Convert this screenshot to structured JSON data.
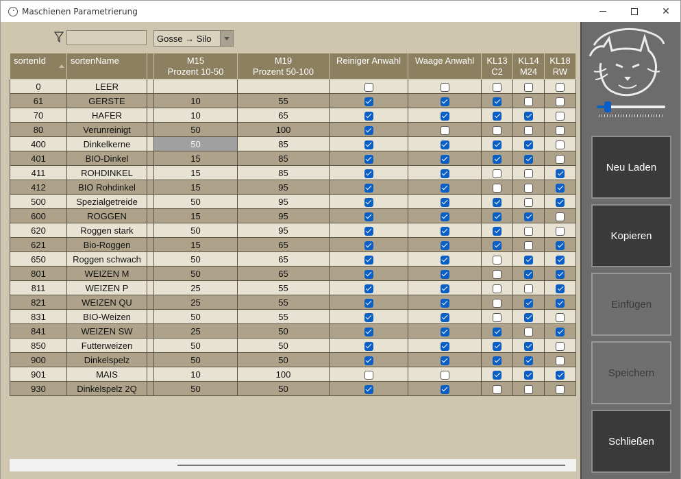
{
  "window": {
    "title": "Maschienen Parametrierung"
  },
  "filter": {
    "value": ""
  },
  "direction": {
    "selected": "Gosse → Silo"
  },
  "table": {
    "headers": [
      {
        "line1": "sortenId",
        "line2": ""
      },
      {
        "line1": "sortenName",
        "line2": ""
      },
      {
        "line1": "",
        "line2": ""
      },
      {
        "line1": "M15",
        "line2": "Prozent 10-50"
      },
      {
        "line1": "M19",
        "line2": "Prozent 50-100"
      },
      {
        "line1": "Reiniger Anwahl",
        "line2": ""
      },
      {
        "line1": "Waage Anwahl",
        "line2": ""
      },
      {
        "line1": "KL13",
        "line2": "C2"
      },
      {
        "line1": "KL14",
        "line2": "M24"
      },
      {
        "line1": "KL18",
        "line2": "RW"
      }
    ],
    "rows": [
      {
        "id": "0",
        "name": "LEER",
        "m15": "",
        "m19": "",
        "reiniger": false,
        "waage": false,
        "kl13": false,
        "kl14": false,
        "kl18": false
      },
      {
        "id": "61",
        "name": "GERSTE",
        "m15": "10",
        "m19": "55",
        "reiniger": true,
        "waage": true,
        "kl13": true,
        "kl14": false,
        "kl18": false
      },
      {
        "id": "70",
        "name": "HAFER",
        "m15": "10",
        "m19": "65",
        "reiniger": true,
        "waage": true,
        "kl13": true,
        "kl14": true,
        "kl18": false
      },
      {
        "id": "80",
        "name": "Verunreinigt",
        "m15": "50",
        "m19": "100",
        "reiniger": true,
        "waage": false,
        "kl13": false,
        "kl14": false,
        "kl18": false
      },
      {
        "id": "400",
        "name": "Dinkelkerne",
        "m15": "50",
        "m19": "85",
        "reiniger": true,
        "waage": true,
        "kl13": true,
        "kl14": true,
        "kl18": false
      },
      {
        "id": "401",
        "name": "BIO-Dinkel",
        "m15": "15",
        "m19": "85",
        "reiniger": true,
        "waage": true,
        "kl13": true,
        "kl14": true,
        "kl18": false
      },
      {
        "id": "411",
        "name": "ROHDINKEL",
        "m15": "15",
        "m19": "85",
        "reiniger": true,
        "waage": true,
        "kl13": false,
        "kl14": false,
        "kl18": true
      },
      {
        "id": "412",
        "name": "BIO Rohdinkel",
        "m15": "15",
        "m19": "95",
        "reiniger": true,
        "waage": true,
        "kl13": false,
        "kl14": false,
        "kl18": true
      },
      {
        "id": "500",
        "name": "Spezialgetreide",
        "m15": "50",
        "m19": "95",
        "reiniger": true,
        "waage": true,
        "kl13": true,
        "kl14": false,
        "kl18": true
      },
      {
        "id": "600",
        "name": "ROGGEN",
        "m15": "15",
        "m19": "95",
        "reiniger": true,
        "waage": true,
        "kl13": true,
        "kl14": true,
        "kl18": false
      },
      {
        "id": "620",
        "name": "Roggen stark",
        "m15": "50",
        "m19": "95",
        "reiniger": true,
        "waage": true,
        "kl13": true,
        "kl14": false,
        "kl18": false
      },
      {
        "id": "621",
        "name": "Bio-Roggen",
        "m15": "15",
        "m19": "65",
        "reiniger": true,
        "waage": true,
        "kl13": true,
        "kl14": false,
        "kl18": true
      },
      {
        "id": "650",
        "name": "Roggen schwach",
        "m15": "50",
        "m19": "65",
        "reiniger": true,
        "waage": true,
        "kl13": false,
        "kl14": true,
        "kl18": true
      },
      {
        "id": "801",
        "name": "WEIZEN M",
        "m15": "50",
        "m19": "65",
        "reiniger": true,
        "waage": true,
        "kl13": false,
        "kl14": true,
        "kl18": true
      },
      {
        "id": "811",
        "name": "WEIZEN P",
        "m15": "25",
        "m19": "55",
        "reiniger": true,
        "waage": true,
        "kl13": false,
        "kl14": false,
        "kl18": true
      },
      {
        "id": "821",
        "name": "WEIZEN QU",
        "m15": "25",
        "m19": "55",
        "reiniger": true,
        "waage": true,
        "kl13": false,
        "kl14": true,
        "kl18": true
      },
      {
        "id": "831",
        "name": "BIO-Weizen",
        "m15": "50",
        "m19": "55",
        "reiniger": true,
        "waage": true,
        "kl13": false,
        "kl14": true,
        "kl18": false
      },
      {
        "id": "841",
        "name": "WEIZEN SW",
        "m15": "25",
        "m19": "50",
        "reiniger": true,
        "waage": true,
        "kl13": true,
        "kl14": false,
        "kl18": true
      },
      {
        "id": "850",
        "name": "Futterweizen",
        "m15": "50",
        "m19": "50",
        "reiniger": true,
        "waage": true,
        "kl13": true,
        "kl14": true,
        "kl18": false
      },
      {
        "id": "900",
        "name": "Dinkelspelz",
        "m15": "50",
        "m19": "50",
        "reiniger": true,
        "waage": true,
        "kl13": true,
        "kl14": true,
        "kl18": false
      },
      {
        "id": "901",
        "name": "MAIS",
        "m15": "10",
        "m19": "100",
        "reiniger": false,
        "waage": false,
        "kl13": true,
        "kl14": true,
        "kl18": true
      },
      {
        "id": "930",
        "name": "Dinkelspelz 2Q",
        "m15": "50",
        "m19": "50",
        "reiniger": true,
        "waage": true,
        "kl13": false,
        "kl14": false,
        "kl18": false
      }
    ]
  },
  "slider": {
    "value_fraction": 0.12
  },
  "buttons": {
    "reload": "Neu Laden",
    "copy": "Kopieren",
    "paste": "Einfügen",
    "save": "Speichern",
    "close": "Schließen"
  },
  "colors": {
    "header_bg": "#8c8060",
    "row_light": "#e8e2d2",
    "row_dark": "#aea38a",
    "panel_bg": "#cfc6b0",
    "sidebar_bg": "#6c6c6c",
    "checkbox_on": "#0b5fc4"
  }
}
